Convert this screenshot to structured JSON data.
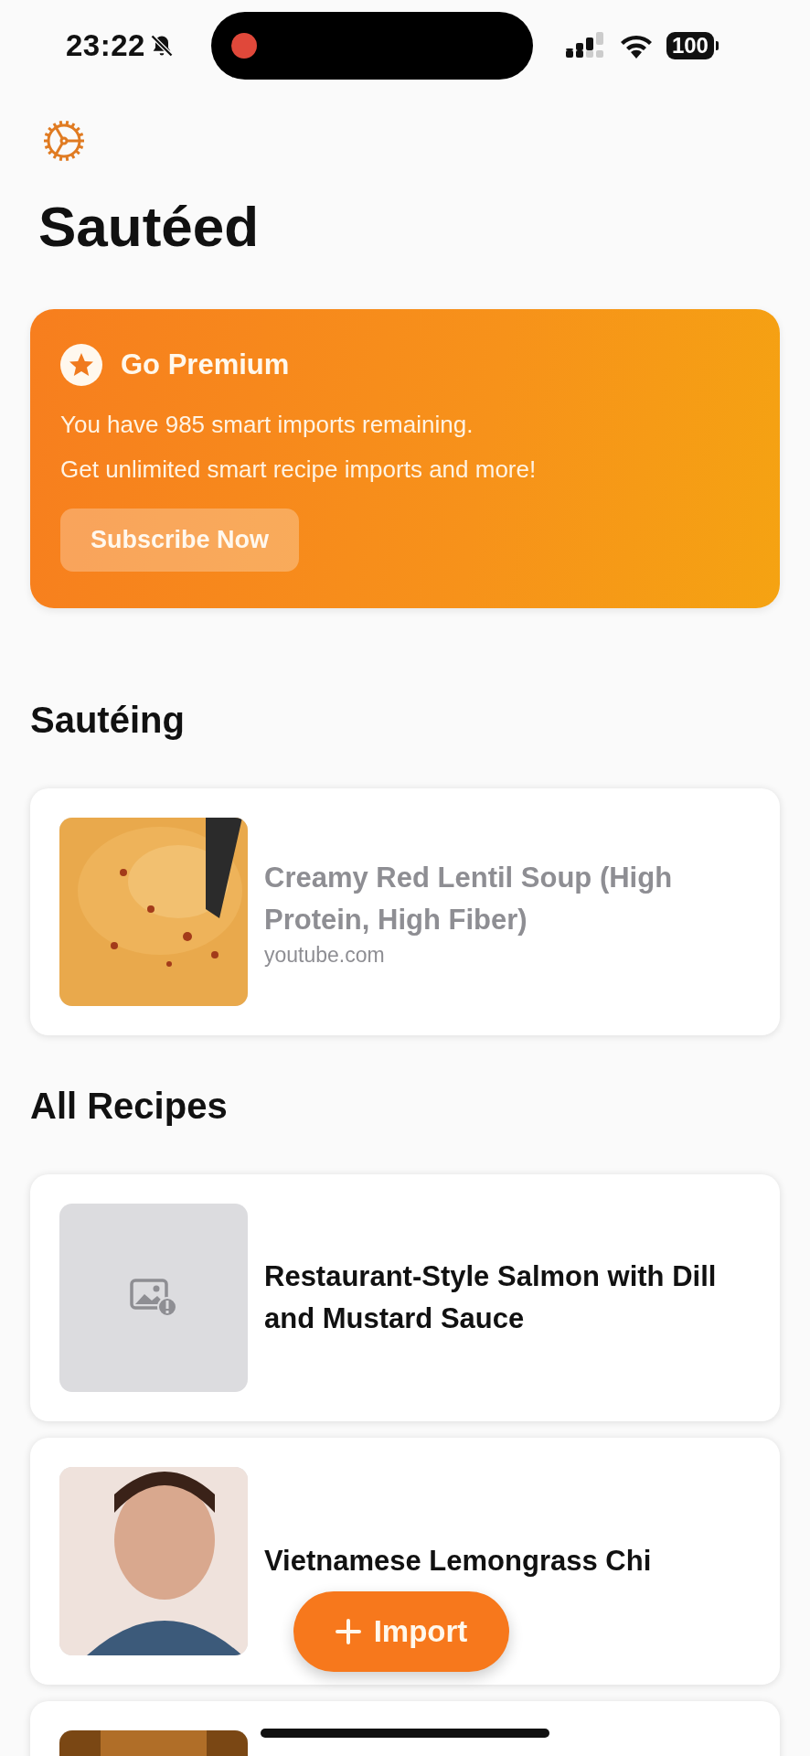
{
  "status_bar": {
    "time": "23:22",
    "silent": true,
    "recording": true,
    "battery": "100"
  },
  "title": "Sautéed",
  "premium": {
    "heading": "Go Premium",
    "lines": [
      "You have 985 smart imports remaining.",
      "Get unlimited smart recipe imports and more!"
    ],
    "button": "Subscribe Now"
  },
  "sections": [
    {
      "title": "Sautéing",
      "recipes": [
        {
          "kind": "picture",
          "title": "Creamy Red Lentil Soup (High Protein, High Fiber)",
          "source": "youtube.com",
          "in_progress": true
        }
      ]
    },
    {
      "title": "All Recipes",
      "recipes": [
        {
          "kind": "placeholder",
          "title": "Restaurant-Style Salmon with Dill and Mustard Sauce",
          "in_progress": false
        },
        {
          "kind": "picture",
          "title": "Vietnamese Lemongrass Chi",
          "in_progress": false
        },
        {
          "kind": "picture"
        }
      ]
    }
  ],
  "import_button": "Import"
}
